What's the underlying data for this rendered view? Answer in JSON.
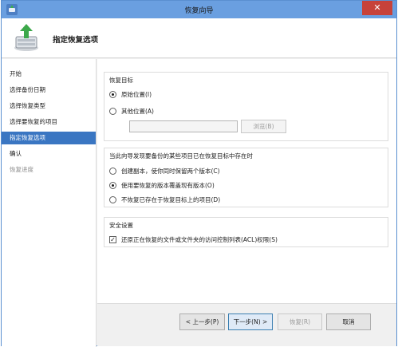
{
  "window": {
    "title": "恢复向导",
    "close_glyph": "✕"
  },
  "header": {
    "title": "指定恢复选项",
    "icon": "restore-server-icon"
  },
  "nav": {
    "items": [
      {
        "label": "开始",
        "state": "normal"
      },
      {
        "label": "选择备份日期",
        "state": "normal"
      },
      {
        "label": "选择恢复类型",
        "state": "normal"
      },
      {
        "label": "选择要恢复的项目",
        "state": "normal"
      },
      {
        "label": "指定恢复选项",
        "state": "active"
      },
      {
        "label": "确认",
        "state": "normal"
      },
      {
        "label": "恢复进度",
        "state": "disabled"
      }
    ]
  },
  "restore_target": {
    "title": "恢复目标",
    "original_label": "原始位置(I)",
    "original_selected": true,
    "other_label": "其他位置(A)",
    "other_selected": false,
    "path_value": "",
    "browse_label": "浏览(B)"
  },
  "conflict": {
    "title": "当此向导发现要备份的某些项目已在恢复目标中存在时",
    "options": [
      {
        "label": "创建副本，使你同时保留两个版本(C)",
        "selected": false
      },
      {
        "label": "使用要恢复的版本覆盖现有版本(O)",
        "selected": true
      },
      {
        "label": "不恢复已存在于恢复目标上的项目(D)",
        "selected": false
      }
    ]
  },
  "security": {
    "title": "安全设置",
    "acl_label": "还原正在恢复的文件或文件夹的访问控制列表(ACL)权限(S)",
    "acl_checked": true,
    "check_glyph": "✓"
  },
  "footer": {
    "back_label": "< 上一步(P)",
    "next_label": "下一步(N) >",
    "restore_label": "恢复(R)",
    "cancel_label": "取消"
  },
  "colors": {
    "titlebar": "#6a9fe0",
    "close": "#c7423a",
    "nav_active": "#3a76c2",
    "primary_border": "#3c7fb1"
  }
}
